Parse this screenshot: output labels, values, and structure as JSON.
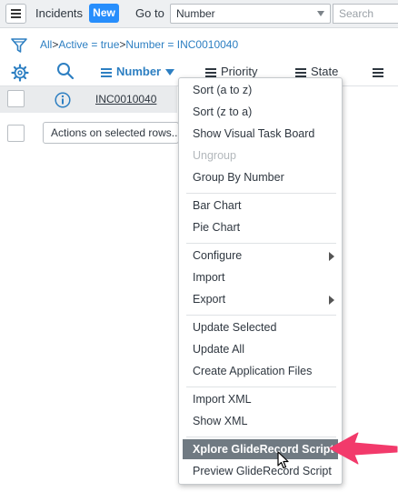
{
  "header": {
    "menu_icon": "hamburger-icon",
    "title": "Incidents",
    "new_label": "New",
    "goto_label": "Go to",
    "goto_value": "Number",
    "search_placeholder": "Search"
  },
  "breadcrumb": {
    "filter_icon": "funnel-icon",
    "parts": [
      "All",
      "Active = true",
      "Number = INC0010040"
    ],
    "separator": ">"
  },
  "columns": {
    "settings_icon": "gear-icon",
    "search_icon": "search-icon",
    "headers": [
      "Number",
      "Priority",
      "State"
    ]
  },
  "row": {
    "info_icon": "info-icon",
    "number": "INC0010040"
  },
  "actions": {
    "label": "Actions on selected rows..."
  },
  "context_menu": {
    "items": [
      {
        "label": "Sort (a to z)"
      },
      {
        "label": "Sort (z to a)"
      },
      {
        "label": "Show Visual Task Board"
      },
      {
        "label": "Ungroup",
        "disabled": true
      },
      {
        "label": "Group By Number"
      },
      {
        "label": "Bar Chart"
      },
      {
        "label": "Pie Chart"
      },
      {
        "label": "Configure",
        "submenu": true
      },
      {
        "label": "Import"
      },
      {
        "label": "Export",
        "submenu": true
      },
      {
        "label": "Update Selected"
      },
      {
        "label": "Update All"
      },
      {
        "label": "Create Application Files"
      },
      {
        "label": "Import XML"
      },
      {
        "label": "Show XML"
      },
      {
        "label": "Xplore GlideRecord Script",
        "highlighted": true
      },
      {
        "label": "Preview GlideRecord Script"
      }
    ]
  },
  "annotation": {
    "arrow_color": "#f23a6b",
    "arrow_icon": "pink-arrow-icon",
    "cursor_icon": "mouse-pointer-icon"
  },
  "colors": {
    "accent_blue": "#278efc",
    "link_blue": "#2d7fc2",
    "highlight_gray": "#707a82"
  }
}
